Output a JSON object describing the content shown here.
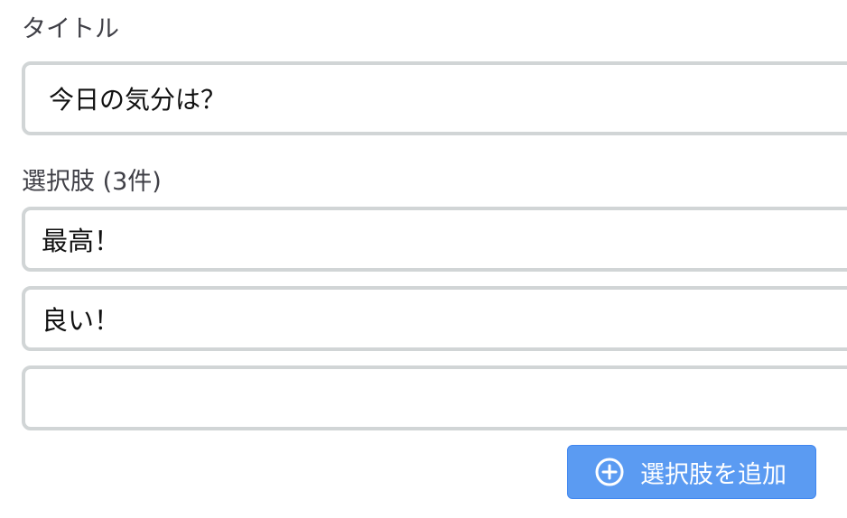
{
  "title_field": {
    "label": "タイトル",
    "value": "今日の気分は？"
  },
  "options_field": {
    "label": "選択肢 (3件)",
    "items": [
      {
        "value": "最高！",
        "placeholder": ""
      },
      {
        "value": "良い！",
        "placeholder": ""
      },
      {
        "value": "",
        "placeholder": ""
      }
    ]
  },
  "add_button": {
    "label": "選択肢を追加",
    "icon": "plus-circle-icon"
  },
  "colors": {
    "button_bg": "#5b9bf2",
    "input_border": "#d1d5d6",
    "label_text": "#3f3f46"
  }
}
